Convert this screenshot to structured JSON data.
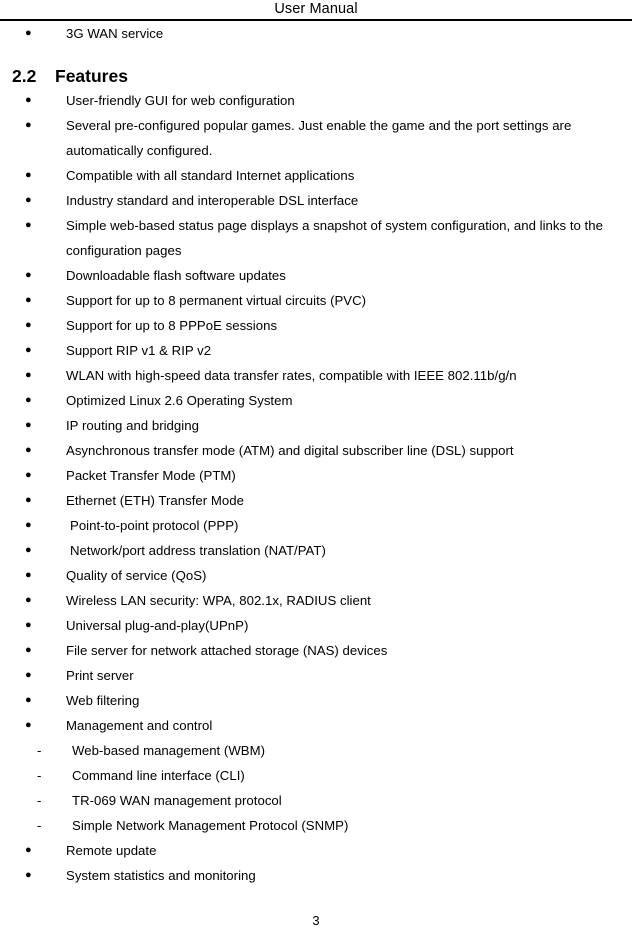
{
  "header": {
    "title": "User Manual"
  },
  "footer": {
    "page_number": "3"
  },
  "section": {
    "number": "2.2",
    "title": "Features"
  },
  "intro_list": [
    {
      "marker": "bullet",
      "text": "3G WAN service"
    }
  ],
  "features_list": [
    {
      "marker": "bullet",
      "text": "User-friendly GUI for web configuration"
    },
    {
      "marker": "bullet",
      "text": "Several pre-configured popular games. Just enable the game and the port settings are automatically configured."
    },
    {
      "marker": "bullet",
      "text": "Compatible with all standard Internet applications"
    },
    {
      "marker": "bullet",
      "text": "Industry standard and interoperable DSL interface"
    },
    {
      "marker": "bullet",
      "text": "Simple web-based status page displays a snapshot of system configuration, and links to the configuration pages"
    },
    {
      "marker": "bullet",
      "text": "Downloadable flash software updates"
    },
    {
      "marker": "bullet",
      "text": "Support for up to 8 permanent virtual circuits (PVC)"
    },
    {
      "marker": "bullet",
      "text": "Support for up to 8 PPPoE sessions"
    },
    {
      "marker": "bullet",
      "text": "Support RIP v1 & RIP v2"
    },
    {
      "marker": "bullet",
      "text": "WLAN with high-speed data transfer rates, compatible with IEEE 802.11b/g/n"
    },
    {
      "marker": "bullet",
      "text": "Optimized Linux 2.6 Operating System"
    },
    {
      "marker": "bullet",
      "text": "IP routing and bridging"
    },
    {
      "marker": "bullet",
      "text": "Asynchronous transfer mode (ATM) and digital subscriber line (DSL) support"
    },
    {
      "marker": "bullet",
      "text": "Packet Transfer Mode (PTM)"
    },
    {
      "marker": "bullet",
      "text": "Ethernet (ETH) Transfer Mode"
    },
    {
      "marker": "bullet",
      "text": "Point-to-point protocol (PPP)",
      "extra_indent": true
    },
    {
      "marker": "bullet",
      "text": "Network/port address translation (NAT/PAT)",
      "extra_indent": true
    },
    {
      "marker": "bullet",
      "text": "Quality of service (QoS)"
    },
    {
      "marker": "bullet",
      "text": "Wireless LAN security: WPA, 802.1x, RADIUS client"
    },
    {
      "marker": "bullet",
      "text": "Universal plug-and-play(UPnP)"
    },
    {
      "marker": "bullet",
      "text": "File server for network attached storage (NAS) devices"
    },
    {
      "marker": "bullet",
      "text": "Print server"
    },
    {
      "marker": "bullet",
      "text": "Web filtering"
    },
    {
      "marker": "bullet",
      "text": "Management and control"
    },
    {
      "marker": "dash",
      "text": "Web-based management (WBM)"
    },
    {
      "marker": "dash",
      "text": "Command line interface (CLI)"
    },
    {
      "marker": "dash",
      "text": "TR-069 WAN management protocol"
    },
    {
      "marker": "dash",
      "text": "Simple Network Management Protocol (SNMP)"
    },
    {
      "marker": "bullet",
      "text": "Remote update"
    },
    {
      "marker": "bullet",
      "text": "System statistics and monitoring"
    }
  ]
}
